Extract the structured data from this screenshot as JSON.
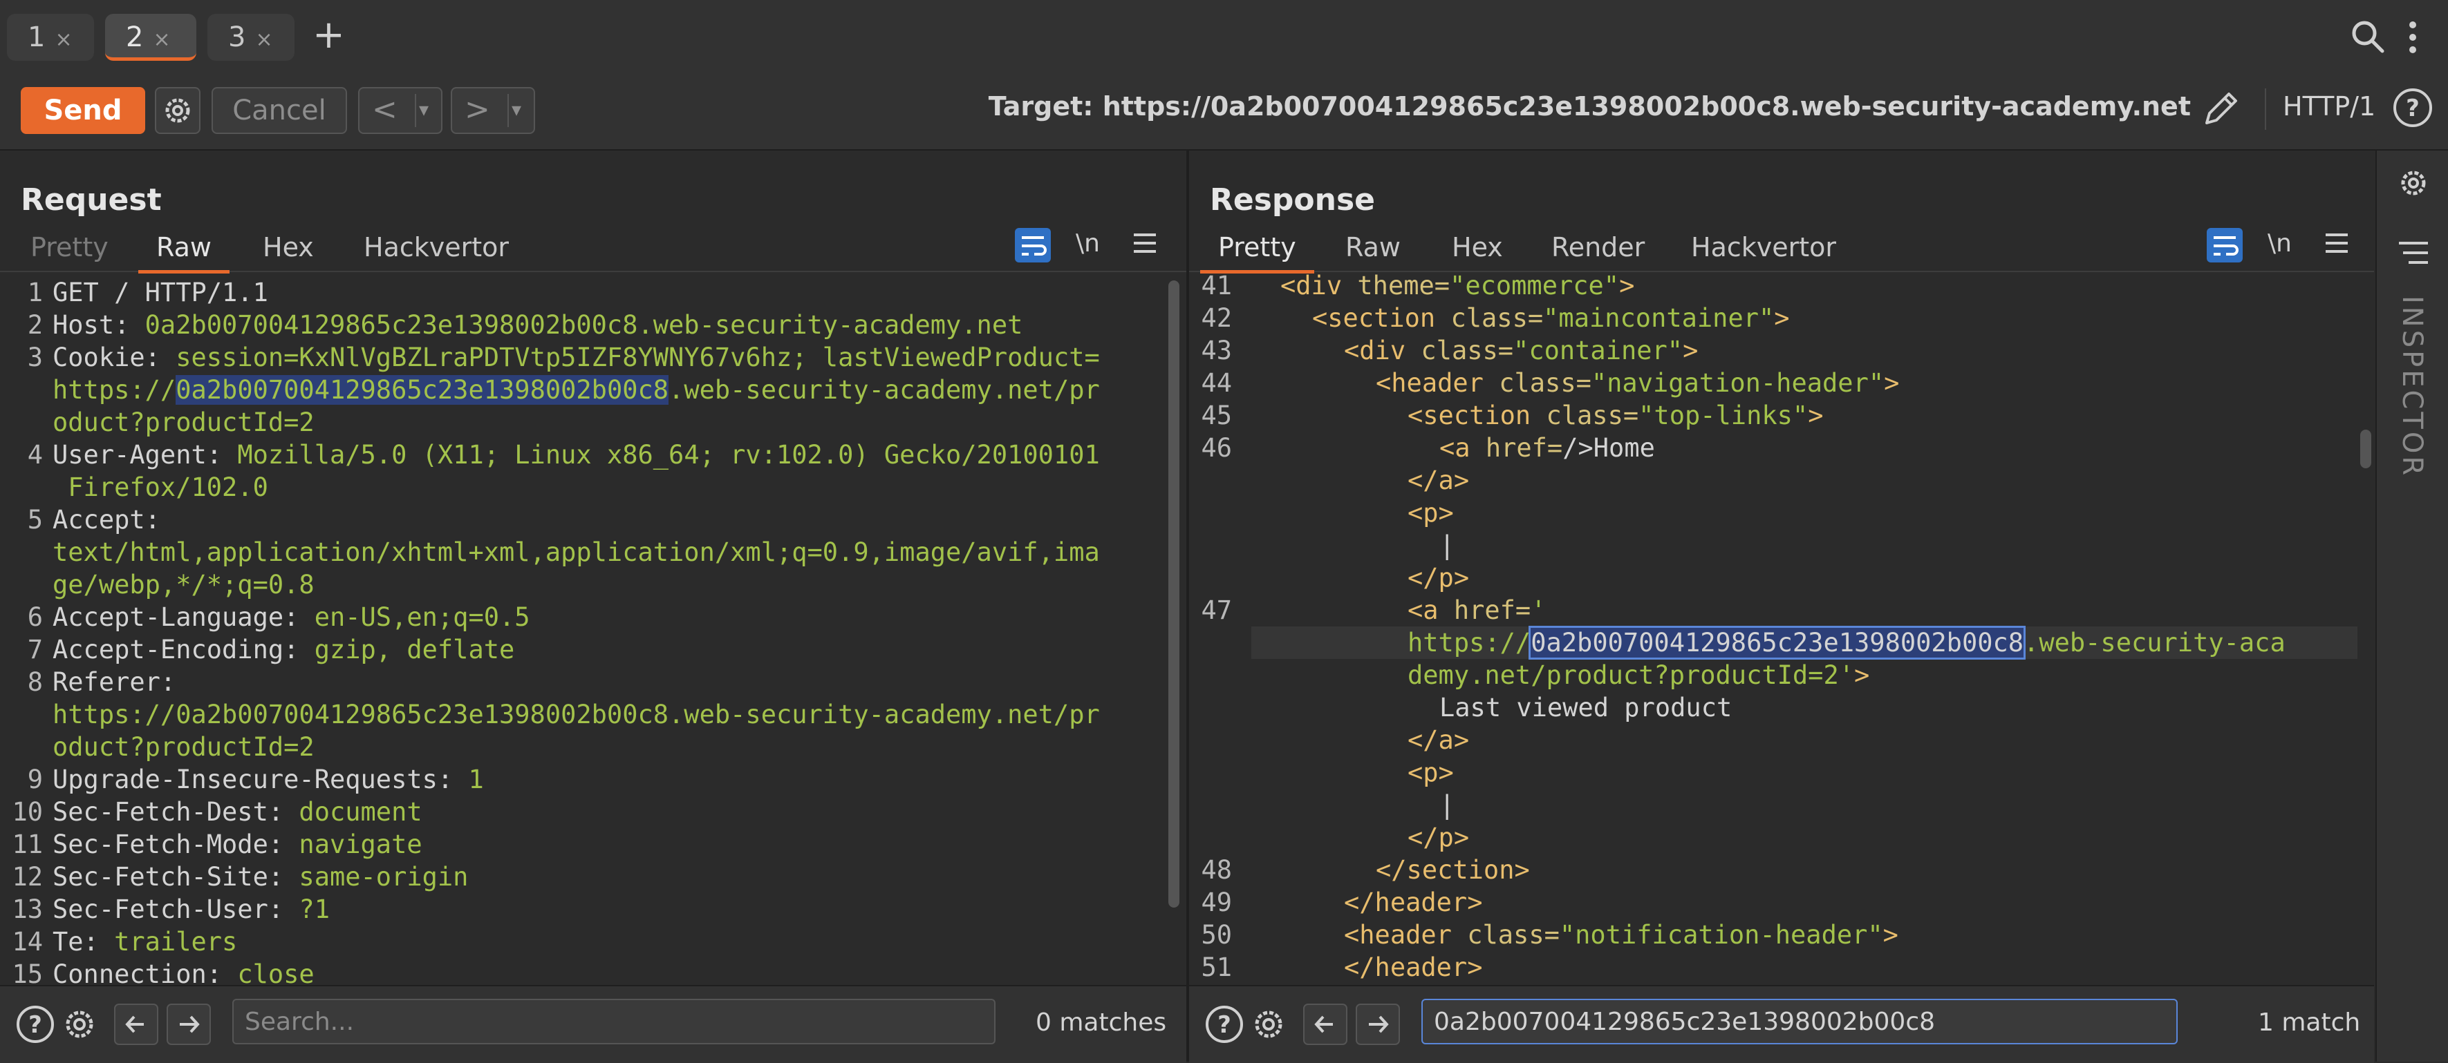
{
  "tabs": [
    {
      "label": "1",
      "close": "×"
    },
    {
      "label": "2",
      "close": "×"
    },
    {
      "label": "3",
      "close": "×"
    }
  ],
  "add_tab": "+",
  "toolbar": {
    "send_label": "Send",
    "cancel_label": "Cancel",
    "back_label": "<",
    "forward_label": ">",
    "dropdown": "▾",
    "target": "Target: https://0a2b007004129865c23e1398002b00c8.web-security-academy.net",
    "http_version": "HTTP/1"
  },
  "request": {
    "title": "Request",
    "tabs": [
      "Pretty",
      "Raw",
      "Hex",
      "Hackvertor"
    ],
    "active_tab": "Raw",
    "newline_toggle": "\\n",
    "lines": [
      {
        "n": "1",
        "k": "GET / HTTP/1.1",
        "v": ""
      },
      {
        "n": "2",
        "k": "Host: ",
        "v": "0a2b007004129865c23e1398002b00c8.web-security-academy.net"
      },
      {
        "n": "3",
        "k": "Cookie: ",
        "v": "session=KxNlVgBZLraPDTVtp5IZF8YWNY67v6hz; lastViewedProduct="
      },
      {
        "n": "",
        "k": "",
        "v": "https://0a2b007004129865c23e1398002b00c8.web-security-academy.net/pr"
      },
      {
        "n": "",
        "k": "",
        "v": "oduct?productId=2"
      },
      {
        "n": "4",
        "k": "User-Agent: ",
        "v": "Mozilla/5.0 (X11; Linux x86_64; rv:102.0) Gecko/20100101"
      },
      {
        "n": "",
        "k": "",
        "v": " Firefox/102.0"
      },
      {
        "n": "5",
        "k": "Accept: ",
        "v": ""
      },
      {
        "n": "",
        "k": "",
        "v": "text/html,application/xhtml+xml,application/xml;q=0.9,image/avif,ima"
      },
      {
        "n": "",
        "k": "",
        "v": "ge/webp,*/*;q=0.8"
      },
      {
        "n": "6",
        "k": "Accept-Language: ",
        "v": "en-US,en;q=0.5"
      },
      {
        "n": "7",
        "k": "Accept-Encoding: ",
        "v": "gzip, deflate"
      },
      {
        "n": "8",
        "k": "Referer: ",
        "v": ""
      },
      {
        "n": "",
        "k": "",
        "v": "https://0a2b007004129865c23e1398002b00c8.web-security-academy.net/pr"
      },
      {
        "n": "",
        "k": "",
        "v": "oduct?productId=2"
      },
      {
        "n": "9",
        "k": "Upgrade-Insecure-Requests: ",
        "v": "1"
      },
      {
        "n": "10",
        "k": "Sec-Fetch-Dest: ",
        "v": "document"
      },
      {
        "n": "11",
        "k": "Sec-Fetch-Mode: ",
        "v": "navigate"
      },
      {
        "n": "12",
        "k": "Sec-Fetch-Site: ",
        "v": "same-origin"
      },
      {
        "n": "13",
        "k": "Sec-Fetch-User: ",
        "v": "?1"
      },
      {
        "n": "14",
        "k": "Te: ",
        "v": "trailers"
      },
      {
        "n": "15",
        "k": "Connection: ",
        "v": "close"
      }
    ],
    "search_placeholder": "Search...",
    "matches": "0 matches"
  },
  "response": {
    "title": "Response",
    "tabs": [
      "Pretty",
      "Raw",
      "Hex",
      "Render",
      "Hackvertor"
    ],
    "active_tab": "Pretty",
    "newline_toggle": "\\n",
    "lines": [
      {
        "n": "41",
        "indent": 1,
        "parts": [
          [
            "tag",
            "<div "
          ],
          [
            "attr",
            "theme="
          ],
          [
            "str",
            "\"ecommerce\""
          ],
          [
            "tag",
            ">"
          ]
        ]
      },
      {
        "n": "42",
        "indent": 2,
        "parts": [
          [
            "tag",
            "<section "
          ],
          [
            "attr",
            "class="
          ],
          [
            "str",
            "\"maincontainer\""
          ],
          [
            "tag",
            ">"
          ]
        ]
      },
      {
        "n": "43",
        "indent": 3,
        "parts": [
          [
            "tag",
            "<div "
          ],
          [
            "attr",
            "class="
          ],
          [
            "str",
            "\"container\""
          ],
          [
            "tag",
            ">"
          ]
        ]
      },
      {
        "n": "44",
        "indent": 4,
        "parts": [
          [
            "tag",
            "<header "
          ],
          [
            "attr",
            "class="
          ],
          [
            "str",
            "\"navigation-header\""
          ],
          [
            "tag",
            ">"
          ]
        ]
      },
      {
        "n": "45",
        "indent": 5,
        "parts": [
          [
            "tag",
            "<section "
          ],
          [
            "attr",
            "class="
          ],
          [
            "str",
            "\"top-links\""
          ],
          [
            "tag",
            ">"
          ]
        ]
      },
      {
        "n": "46",
        "indent": 6,
        "parts": [
          [
            "tag",
            "<a "
          ],
          [
            "attr",
            "href="
          ],
          [
            "k",
            "/>Home"
          ]
        ]
      },
      {
        "n": "",
        "indent": 5,
        "parts": [
          [
            "tag",
            "</a>"
          ]
        ]
      },
      {
        "n": "",
        "indent": 5,
        "parts": [
          [
            "tag",
            "<p>"
          ]
        ]
      },
      {
        "n": "",
        "indent": 6,
        "parts": [
          [
            "k",
            "|"
          ]
        ]
      },
      {
        "n": "",
        "indent": 5,
        "parts": [
          [
            "tag",
            "</p>"
          ]
        ]
      },
      {
        "n": "47",
        "indent": 5,
        "parts": [
          [
            "tag",
            "<a "
          ],
          [
            "attr",
            "href="
          ],
          [
            "str",
            "'"
          ]
        ]
      },
      {
        "n": "",
        "indent": 5,
        "parts": [
          [
            "str",
            "https://"
          ],
          [
            "hlbox",
            "0a2b007004129865c23e1398002b00c8"
          ],
          [
            "str",
            ".web-security-aca"
          ]
        ]
      },
      {
        "n": "",
        "indent": 5,
        "parts": [
          [
            "str",
            "demy.net/product?productId=2'"
          ],
          [
            "tag",
            ">"
          ]
        ]
      },
      {
        "n": "",
        "indent": 6,
        "parts": [
          [
            "k",
            "Last viewed product"
          ]
        ]
      },
      {
        "n": "",
        "indent": 5,
        "parts": [
          [
            "tag",
            "</a>"
          ]
        ]
      },
      {
        "n": "",
        "indent": 5,
        "parts": [
          [
            "tag",
            "<p>"
          ]
        ]
      },
      {
        "n": "",
        "indent": 6,
        "parts": [
          [
            "k",
            "|"
          ]
        ]
      },
      {
        "n": "",
        "indent": 5,
        "parts": [
          [
            "tag",
            "</p>"
          ]
        ]
      },
      {
        "n": "48",
        "indent": 4,
        "parts": [
          [
            "tag",
            "</section>"
          ]
        ]
      },
      {
        "n": "49",
        "indent": 3,
        "parts": [
          [
            "tag",
            "</header>"
          ]
        ]
      },
      {
        "n": "50",
        "indent": 3,
        "parts": [
          [
            "tag",
            "<header "
          ],
          [
            "attr",
            "class="
          ],
          [
            "str",
            "\"notification-header\""
          ],
          [
            "tag",
            ">"
          ]
        ]
      },
      {
        "n": "51",
        "indent": 3,
        "parts": [
          [
            "tag",
            "</header>"
          ]
        ]
      }
    ],
    "search_value": "0a2b007004129865c23e1398002b00c8",
    "matches": "1 match"
  },
  "inspector_label": "INSPECTOR",
  "colors": {
    "accent": "#e8692c",
    "highlight": "#2c3f78",
    "string": "#a3c24b",
    "tag": "#e8bd6d"
  }
}
